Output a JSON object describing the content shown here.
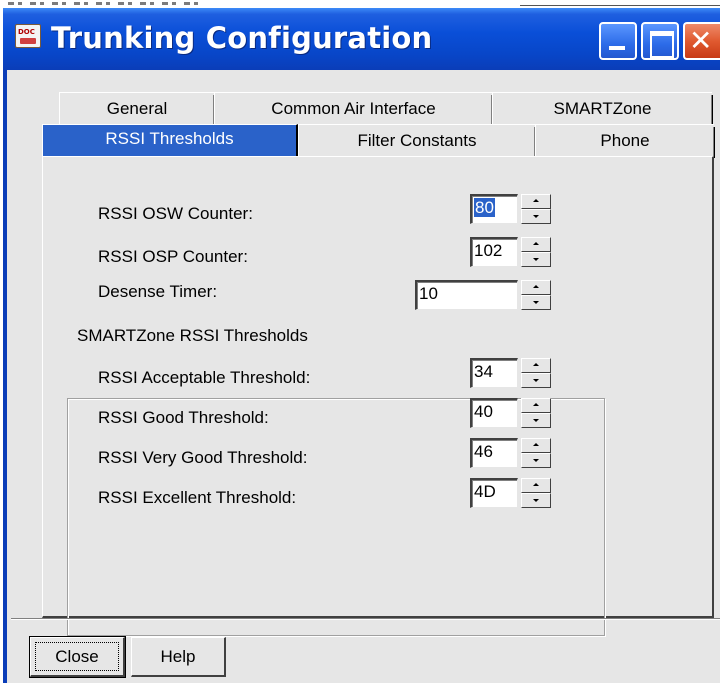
{
  "window": {
    "title": "Trunking Configuration",
    "icon_text": "DOC",
    "icon": "app-doc-icon",
    "buttons": [
      "minimize",
      "maximize",
      "close"
    ]
  },
  "tabs": {
    "row1": [
      "General",
      "Common Air Interface",
      "SMARTZone"
    ],
    "row2": [
      "RSSI Thresholds",
      "Filter Constants",
      "Phone"
    ],
    "active": "RSSI Thresholds"
  },
  "fields": {
    "osw_counter": {
      "label": "RSSI OSW Counter:",
      "value": "80"
    },
    "osp_counter": {
      "label": "RSSI OSP Counter:",
      "value": "102"
    },
    "desense_timer": {
      "label": "Desense Timer:",
      "value": "10"
    }
  },
  "group": {
    "title": "SMARTZone RSSI Thresholds",
    "acceptable": {
      "label": "RSSI Acceptable Threshold:",
      "value": "34"
    },
    "good": {
      "label": "RSSI Good Threshold:",
      "value": "40"
    },
    "very_good": {
      "label": "RSSI Very Good Threshold:",
      "value": "46"
    },
    "excellent": {
      "label": "RSSI Excellent Threshold:",
      "value": "4D"
    }
  },
  "footer": {
    "close_label": "Close",
    "help_label": "Help"
  },
  "colors": {
    "titlebar": "#0a4fd8",
    "active_tab": "#2a62c9",
    "face": "#e6e6e6",
    "close_button": "#e05a30"
  }
}
